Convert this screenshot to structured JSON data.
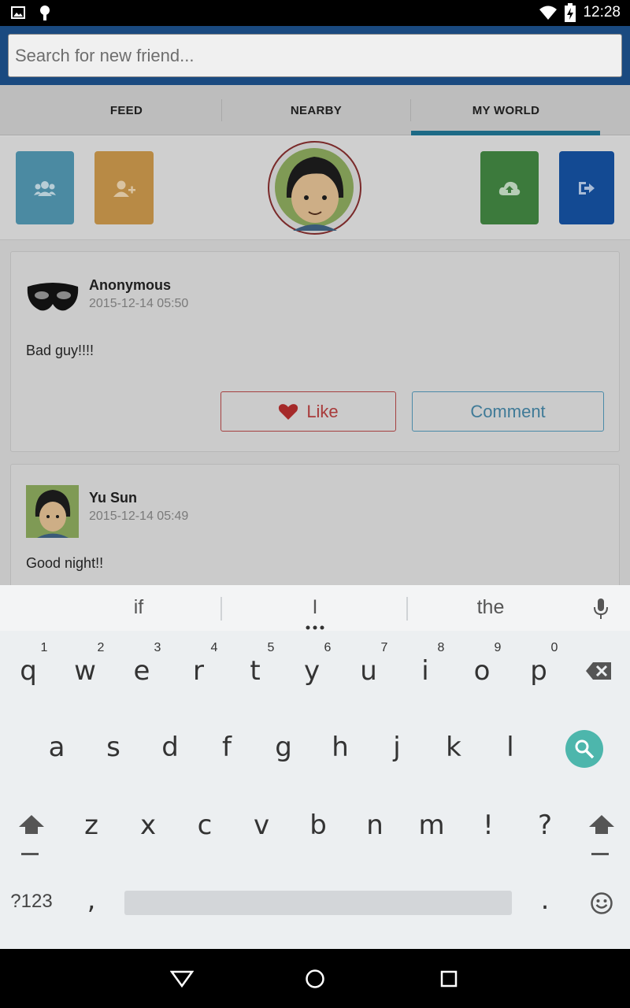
{
  "status_bar": {
    "time": "12:28"
  },
  "search": {
    "placeholder": "Search for new friend..."
  },
  "tabs": [
    {
      "label": "FEED",
      "selected": false
    },
    {
      "label": "NEARBY",
      "selected": false
    },
    {
      "label": "MY WORLD",
      "selected": true
    }
  ],
  "profile_bar": {
    "actions": [
      {
        "icon": "friends-icon",
        "color": "#4aa3c9"
      },
      {
        "icon": "add-friend-icon",
        "color": "#e8a035"
      },
      {
        "icon": "cloud-upload-icon",
        "color": "#3f9c3f"
      },
      {
        "icon": "logout-icon",
        "color": "#0b5fbf"
      }
    ]
  },
  "feed": {
    "posts": [
      {
        "author": "Anonymous",
        "time": "2015-12-14 05:50",
        "text": "Bad guy!!!!",
        "like_label": "Like",
        "comment_label": "Comment"
      },
      {
        "author": "Yu Sun",
        "time": "2015-12-14 05:49",
        "text": "Good night!!"
      }
    ]
  },
  "keyboard": {
    "suggestions": [
      "if",
      "I",
      "the"
    ],
    "row1": [
      "q",
      "w",
      "e",
      "r",
      "t",
      "y",
      "u",
      "i",
      "o",
      "p"
    ],
    "row1_hints": [
      "1",
      "2",
      "3",
      "4",
      "5",
      "6",
      "7",
      "8",
      "9",
      "0"
    ],
    "row2": [
      "a",
      "s",
      "d",
      "f",
      "g",
      "h",
      "j",
      "k",
      "l"
    ],
    "row3": [
      "z",
      "x",
      "c",
      "v",
      "b",
      "n",
      "m",
      "!",
      "?"
    ],
    "symbols_label": "?123",
    "comma": ",",
    "period": ".",
    "accent_color": "#4db6ac"
  }
}
